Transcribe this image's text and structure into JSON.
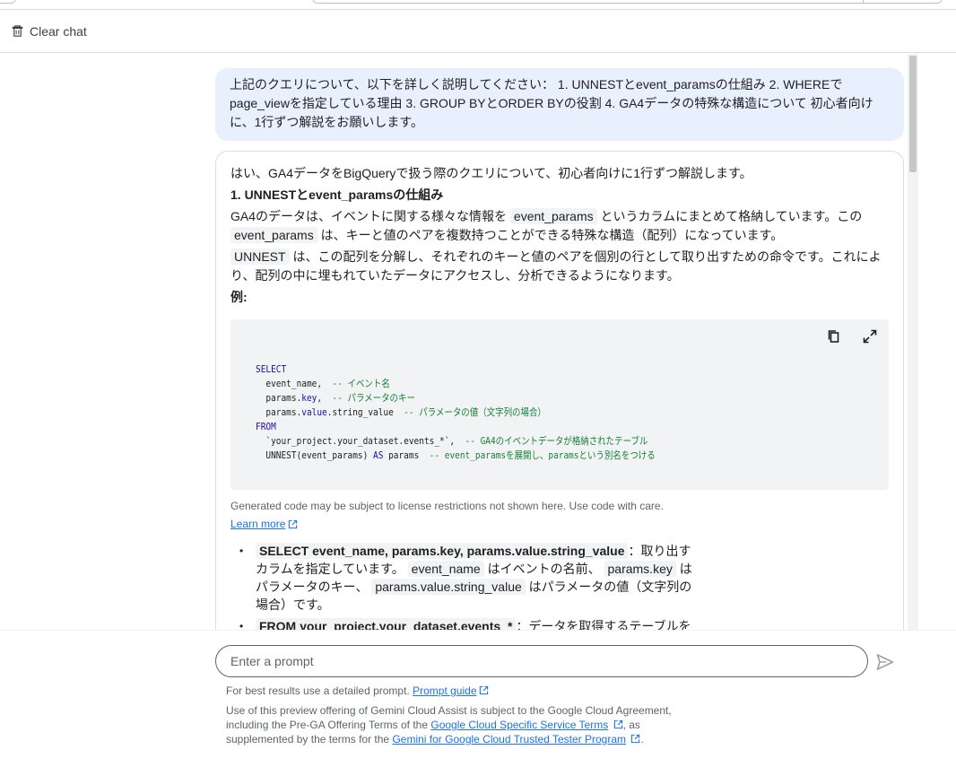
{
  "header": {
    "clear_chat_label": "Clear chat"
  },
  "user_message": "上記のクエリについて、以下を詳しく説明してください： 1. UNNESTとevent_paramsの仕組み 2. WHEREでpage_viewを指定している理由 3. GROUP BYとORDER BYの役割 4. GA4データの特殊な構造について 初心者向けに、1行ずつ解説をお願いします。",
  "response": {
    "intro": "はい、GA4データをBigQueryで扱う際のクエリについて、初心者向けに1行ずつ解説します。",
    "heading1": "1. UNNESTとevent_paramsの仕組み",
    "para1": {
      "a": "GA4のデータは、イベントに関する様々な情報を",
      "code1": "event_params",
      "b": "というカラムにまとめて格納しています。この",
      "code2": "event_params",
      "c": "は、キーと値のペアを複数持つことができる特殊な構造（配列）になっています。"
    },
    "para2": {
      "code1": "UNNEST",
      "a": "は、この配列を分解し、それぞれのキーと値のペアを個別の行として取り出すための命令です。これにより、配列の中に埋もれていたデータにアクセスし、分析できるようになります。"
    },
    "example_label": "例:",
    "code": {
      "l1": "SELECT",
      "l2a": "  event_name,",
      "l2c": "  -- イベント名",
      "l3a": "  params.",
      "l3k": "key",
      "l3b": ",",
      "l3c": "  -- パラメータのキー",
      "l4a": "  params.",
      "l4k": "value",
      "l4b": ".string_value",
      "l4c": "  -- パラメータの値（文字列の場合）",
      "l5": "FROM",
      "l6a": "  `your_project.your_dataset.events_*`,",
      "l6c": "  -- GA4のイベントデータが格納されたテーブル",
      "l7a": "  UNNEST(event_params) ",
      "l7k": "AS",
      "l7b": " params",
      "l7c": "  -- event_paramsを展開し、paramsという別名をつける"
    },
    "disclaimer": "Generated code may be subject to license restrictions not shown here. Use code with care.",
    "learn_more": "Learn more",
    "bullet1": {
      "code": "SELECT event_name, params.key, params.value.string_value",
      "a": "：取り出すカラムを指定しています。",
      "c1": "event_name",
      "b": "はイベントの名前、",
      "c2": "params.key",
      "c": "はパラメータのキー、",
      "c3": "params.value.string_value",
      "d": "はパラメータの値（文字列の場合）です。"
    },
    "bullet2": {
      "code": "FROM your_project.your_dataset.events_*",
      "a": "：データを取得するテーブルを指"
    }
  },
  "input": {
    "placeholder": "Enter a prompt",
    "hint_prefix": "For best results use a detailed prompt.",
    "prompt_guide": "Prompt guide",
    "terms_a": "Use of this preview offering of Gemini Cloud Assist is subject to the Google Cloud Agreement, including the Pre-GA Offering Terms of the",
    "terms_link1": "Google Cloud Specific Service Terms",
    "terms_b": ", as supplemented by the terms for the",
    "terms_link2": "Gemini for Google Cloud Trusted Tester Program",
    "terms_c": "."
  }
}
